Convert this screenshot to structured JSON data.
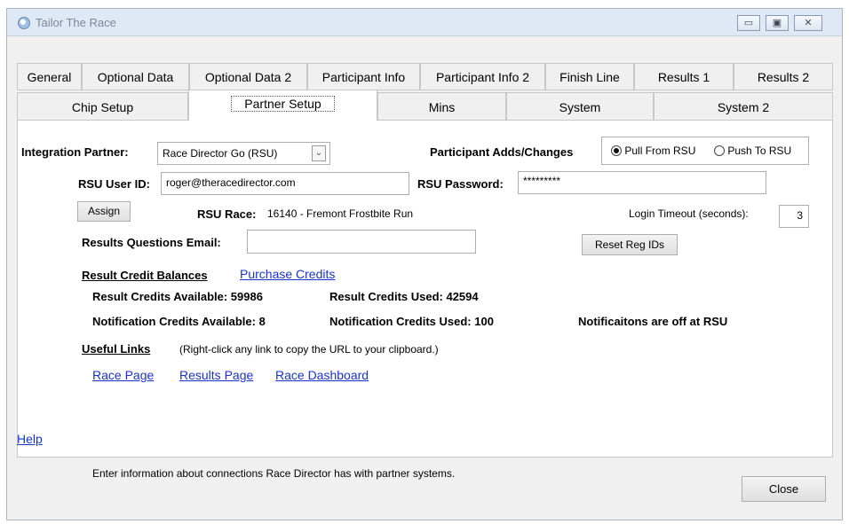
{
  "window": {
    "title": "Tailor The Race",
    "buttons": {
      "minimize": "▭",
      "maximize": "▣",
      "close": "✕"
    }
  },
  "tabs_row1": [
    "General",
    "Optional Data",
    "Optional Data 2",
    "Participant Info",
    "Participant Info 2",
    "Finish Line",
    "Results 1",
    "Results 2"
  ],
  "tabs_row2": [
    "Chip Setup",
    "Partner Setup",
    "Mins",
    "System",
    "System 2"
  ],
  "active_tab": "Partner Setup",
  "form": {
    "integration_partner_label": "Integration Partner:",
    "integration_partner_value": "Race Director Go (RSU)",
    "participant_adds_label": "Participant Adds/Changes",
    "radio_pull": "Pull From RSU",
    "radio_push": "Push To RSU",
    "radio_selected": "pull",
    "user_id_label": "RSU User ID:",
    "user_id_value": "roger@theracedirector.com",
    "password_label": "RSU Password:",
    "password_value": "*********",
    "assign_button": "Assign",
    "rsu_race_label": "RSU Race:",
    "rsu_race_value": "16140 - Fremont Frostbite Run",
    "login_timeout_label": "Login Timeout (seconds):",
    "login_timeout_value": "3",
    "results_email_label": "Results Questions Email:",
    "results_email_value": "",
    "reset_reg_ids_button": "Reset Reg IDs"
  },
  "credits": {
    "heading": "Result Credit Balances",
    "purchase_link": "Purchase Credits",
    "result_available": "Result Credits Available: 59986",
    "result_used": "Result Credits Used: 42594",
    "notification_available": "Notification Credits Available: 8",
    "notification_used": "Notification Credits Used: 100",
    "notification_status": "Notificaitons are off at RSU"
  },
  "links": {
    "heading": "Useful Links",
    "hint": "(Right-click any link to copy the URL to your clipboard.)",
    "race_page": "Race Page",
    "results_page": "Results Page",
    "race_dashboard": "Race Dashboard"
  },
  "help_link": "Help",
  "status_text": "Enter information about connections Race Director has with partner systems.",
  "close_button": "Close",
  "colors": {
    "link": "#1a33cc",
    "titlebar": "#dfe9f5"
  }
}
